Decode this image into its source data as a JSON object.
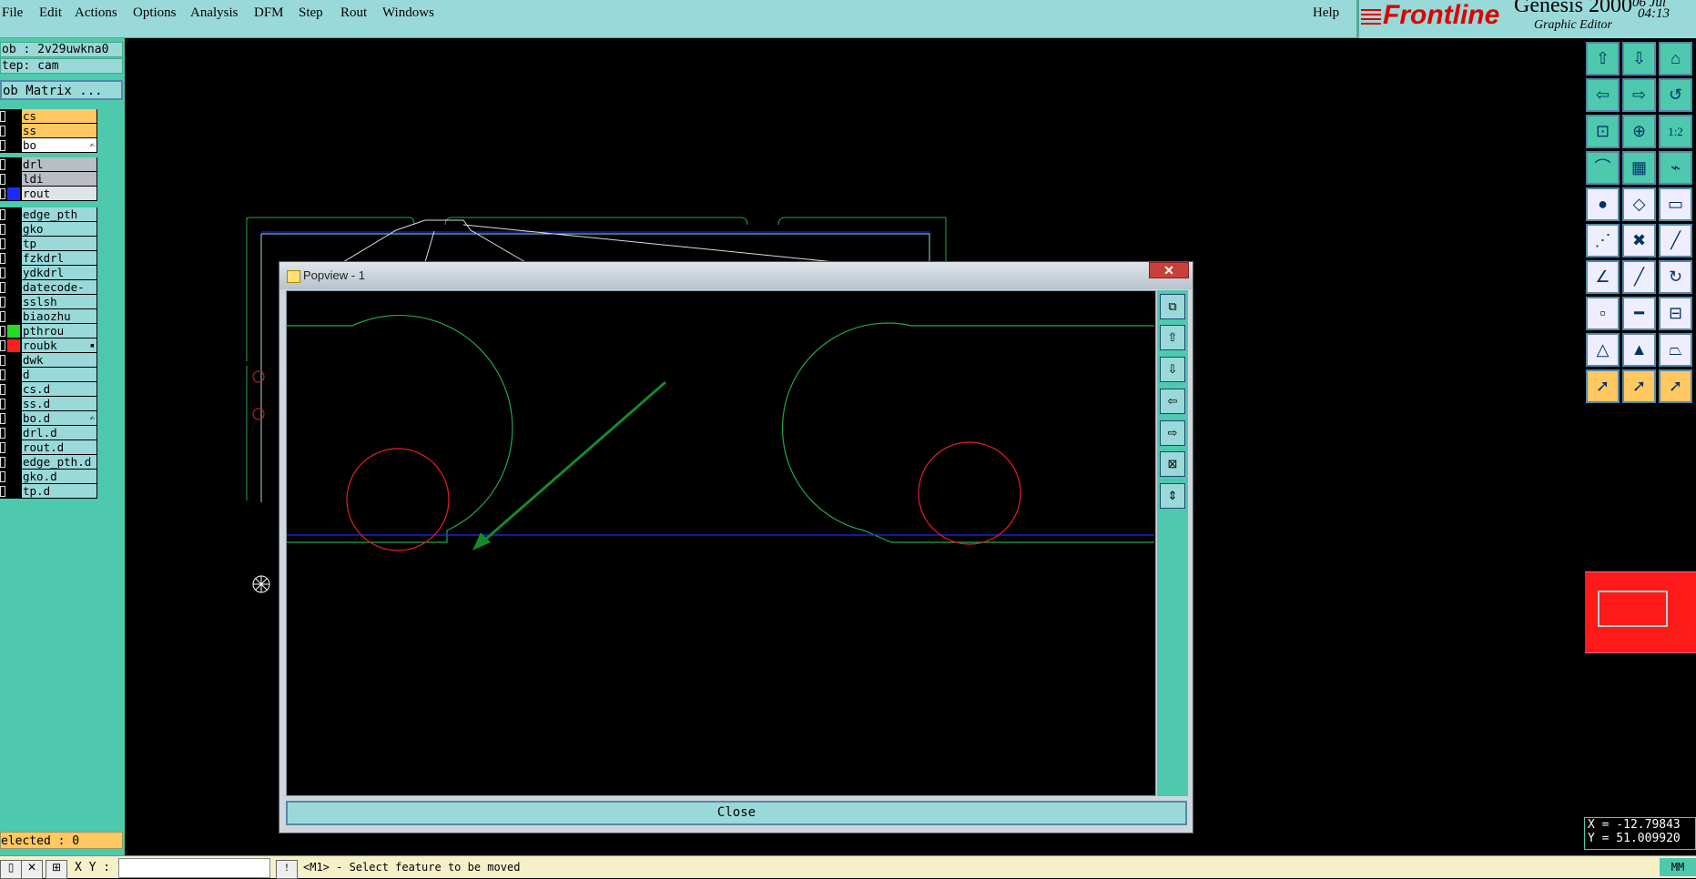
{
  "menu": [
    "File",
    "Edit",
    "Actions",
    "Options",
    "Analysis",
    "DFM",
    "Step",
    "Rout",
    "Windows"
  ],
  "help": "Help",
  "brand": {
    "logo": "Frontline",
    "product": "Genesis 2000",
    "subtitle": "Graphic Editor",
    "date": "06 Jul",
    "time": "04:13"
  },
  "job": "ob : 2v29uwkna0",
  "step": "tep: cam",
  "job_matrix": "ob Matrix ...",
  "layer_groups": [
    [
      {
        "name": "cs",
        "bg": "#ffc860"
      },
      {
        "name": "ss",
        "bg": "#ffc860"
      },
      {
        "name": "bo",
        "bg": "#ffffff",
        "icon": "✍"
      }
    ],
    [
      {
        "name": "drl",
        "bg": "#b8bec4"
      },
      {
        "name": "ldi",
        "bg": "#b8bec4"
      },
      {
        "name": "rout",
        "bg": "#dfe4e8",
        "swatch": "#1a2cff"
      }
    ],
    [
      {
        "name": "edge_pth",
        "bg": "#9ad9d9"
      },
      {
        "name": "gko",
        "bg": "#9ad9d9"
      },
      {
        "name": "tp",
        "bg": "#9ad9d9"
      },
      {
        "name": "fzkdrl",
        "bg": "#9ad9d9"
      },
      {
        "name": "ydkdrl",
        "bg": "#9ad9d9"
      },
      {
        "name": "datecode-bo",
        "bg": "#9ad9d9"
      },
      {
        "name": "sslsh",
        "bg": "#9ad9d9"
      },
      {
        "name": "biaozhu",
        "bg": "#9ad9d9"
      },
      {
        "name": "pthrou",
        "bg": "#9ad9d9",
        "swatch": "#22dd22"
      },
      {
        "name": "roubk",
        "bg": "#9ad9d9",
        "swatch": "#ff2020",
        "icon": "▪"
      },
      {
        "name": "dwk",
        "bg": "#9ad9d9"
      },
      {
        "name": "d",
        "bg": "#9ad9d9"
      },
      {
        "name": "cs.d",
        "bg": "#9ad9d9"
      },
      {
        "name": "ss.d",
        "bg": "#9ad9d9"
      },
      {
        "name": "bo.d",
        "bg": "#9ad9d9",
        "icon": "✍"
      },
      {
        "name": "drl.d",
        "bg": "#9ad9d9"
      },
      {
        "name": "rout.d",
        "bg": "#9ad9d9"
      },
      {
        "name": "edge_pth.d",
        "bg": "#9ad9d9"
      },
      {
        "name": "gko.d",
        "bg": "#9ad9d9"
      },
      {
        "name": "tp.d",
        "bg": "#9ad9d9"
      }
    ]
  ],
  "selected": "elected : 0",
  "popview": {
    "title": "Popview - 1",
    "close_x": "✕",
    "close_label": "Close"
  },
  "popview_tools": [
    "zoom-window-icon",
    "zoom-home-icon",
    "zoom-fit-icon",
    "pan-left-icon",
    "pan-right-icon",
    "zoom-out-icon",
    "zoom-in-icon"
  ],
  "tools": [
    [
      "tool-page-up-icon",
      "tool-page-down-icon",
      "tool-home-icon"
    ],
    [
      "tool-pan-left-icon",
      "tool-pan-right-icon",
      "tool-undo-view-icon"
    ],
    [
      "tool-zoom-fit-icon",
      "tool-zoom-center-icon",
      "tool-scale-icon"
    ],
    [
      "tool-snap-icon",
      "tool-grid-icon",
      "tool-measure-icon"
    ],
    [
      "tool-pad-icon",
      "tool-shape-icon",
      "tool-ruler-icon"
    ],
    [
      "tool-connect-icon",
      "tool-delete-icon",
      "tool-line-icon"
    ],
    [
      "tool-draw-line-icon",
      "tool-edit-line-icon",
      "tool-arc-icon"
    ],
    [
      "tool-move-pad-icon",
      "tool-split-icon",
      "tool-align-icon"
    ],
    [
      "tool-select-area-icon",
      "tool-select-point-icon",
      "tool-select-poly-icon"
    ],
    [
      "tool-pointer-icon",
      "tool-pointer-2-icon",
      "tool-pointer-3-icon"
    ]
  ],
  "tool_labels": {
    "scale": "1:2"
  },
  "coords": {
    "x": "X = -12.79843",
    "y": "Y = 51.009920"
  },
  "bottom": {
    "xy_label": "X Y :",
    "message": "<M1> - Select feature to be moved",
    "units": "MM"
  },
  "colors": {
    "teal": "#4ec9ad",
    "light_teal": "#9ad9d9",
    "orange": "#ffc860",
    "green_line": "#1fa84a",
    "red_circle": "#e52020",
    "blue_line": "#1a2cff"
  }
}
